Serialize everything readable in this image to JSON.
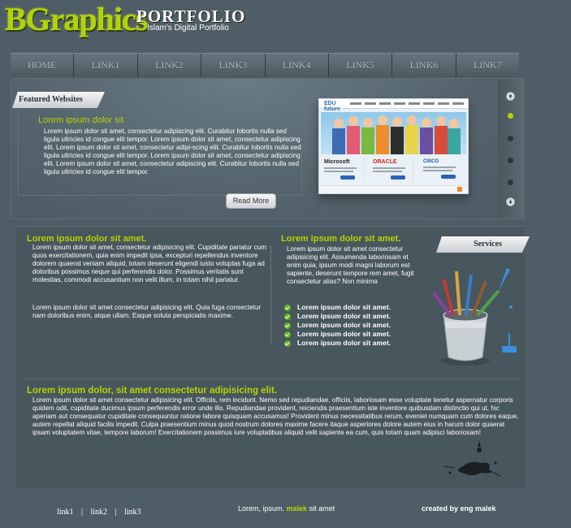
{
  "header": {
    "logo": "BGraphics",
    "subtitle": "PORTFOLIO",
    "tagline": "Islam's Digital Portfolio"
  },
  "nav": [
    "HOME",
    "LINK1",
    "LINK2",
    "LINK3",
    "LINK4",
    "LINK5",
    "LINK6",
    "LINK7"
  ],
  "slider": {
    "tab": "Featured Websites",
    "title": "Lorem ipsum dolor sit",
    "text": "Lorem ipsum dolor sit amet, consectetur adipiscing elit. Curabitur lobortis nulla sed ligula ultricies id congue elit tempor. Lorem ipsum dolor sit amet, consectetur adipiscing elit. Lorem ipsum dolor sit amet, consectetur adipi-scing elit. Curabitur lobortis nulla sed ligula ultricies id congue elit tempor. Lorem ipsum dolor sit amet, consectetur adipiscing elit. Lorem ipsum dolor sit amet, consectetur adipiscing elit. Curabitur lobortis nulla sed ligula ultricies id congue elit tempor.",
    "button": "Read More",
    "thumb": {
      "logo": "EDU future",
      "brands": [
        "Microsoft",
        "ORACLE",
        "CISCO"
      ]
    }
  },
  "content": {
    "left": {
      "heading": "Lorem ipsum dolor sit amet.",
      "para1": "Lorem ipsum dolor sit amet, consectetur adipisicing elit. Cupiditate pariatur cum quos exercitationem, quia enim impedit ipsa, excepturi repellendus inventore dolorem quaerat veniam aliquid, totam deserunt eligendi iusto voluptas fuga ad doloribus possimus neque qui perferendis dolor. Possimus veritatis sunt molestias, commodi accusantium non velit illum, in totam nihil pariatur.",
      "para2": "Lorem ipsum dolor sit amet consectetur adipisicing elit. Quia fuga consectetur nam doloribus enim, atque ullam. Eaque soluta perspiciatis maxime."
    },
    "right": {
      "heading": "Lorem ipsum dolor sit amet.",
      "text": "Lorem ipsum dolor sit amet consectetur adipisicing elit. Assumenda laboriosam et enim quia, ipsum modi magni laborum est sapiente, deserunt tempore rem amet, fugit consectetur alias? Non minima",
      "tab": "Services",
      "list": [
        "Lorem ipsum dolor sit amet.",
        "Lorem ipsum dolor sit amet.",
        "Lorem ipsum dolor sit amet.",
        "Lorem ipsum dolor sit amet.",
        "Lorem ipsum dolor sit amet."
      ]
    },
    "bottom": {
      "heading": "Lorem ipsum dolor, sit amet consectetur adipisicing elit.",
      "text": "Lorem ipsum dolor sit amet consectetur adipisicing elit. Officiis, rem incidunt. Nemo sed repudiandae, officiis, laboriosam esse voluptate tenetur aspernatur corporis quidem odit, cupiditate ducimus ipsum perferendis error unde illo. Repudiandae provident, reiciendis praesentium iste inventore quibusdam distinctio qui ut, hic aperiam aut consequatur cupiditate consequuntur ratione labore quisquam accusamus! Provident minus necessitatibus rerum, eveniet numquam cum dolores eaque, autem repellat aliquid facilis impedit. Culpa praesentium minus quod nostrum dolores maxime facere itaque asperiores dolore autem eius in harum dolor quaerat ipsam voluptatem vitae, tempore laborum! Exercitationem possimus iure voluptatibus aliquid velit sapiente ea cum, quis totam quam adipisci laboriosam!"
    }
  },
  "footer": {
    "links": [
      "link1",
      "link2",
      "link3"
    ],
    "center_pre": "Lorem, ipsum.",
    "center_highlight": "malek",
    "center_post": "sit amet",
    "credit": "created by eng malek"
  },
  "colors": {
    "accent": "#b3d400",
    "background": "#4e5d66",
    "check": "#62b61e"
  },
  "icons": [
    "arrow-up-icon",
    "arrow-down-icon",
    "check-icon",
    "paint-bucket-icon",
    "paint-splash-icon"
  ]
}
